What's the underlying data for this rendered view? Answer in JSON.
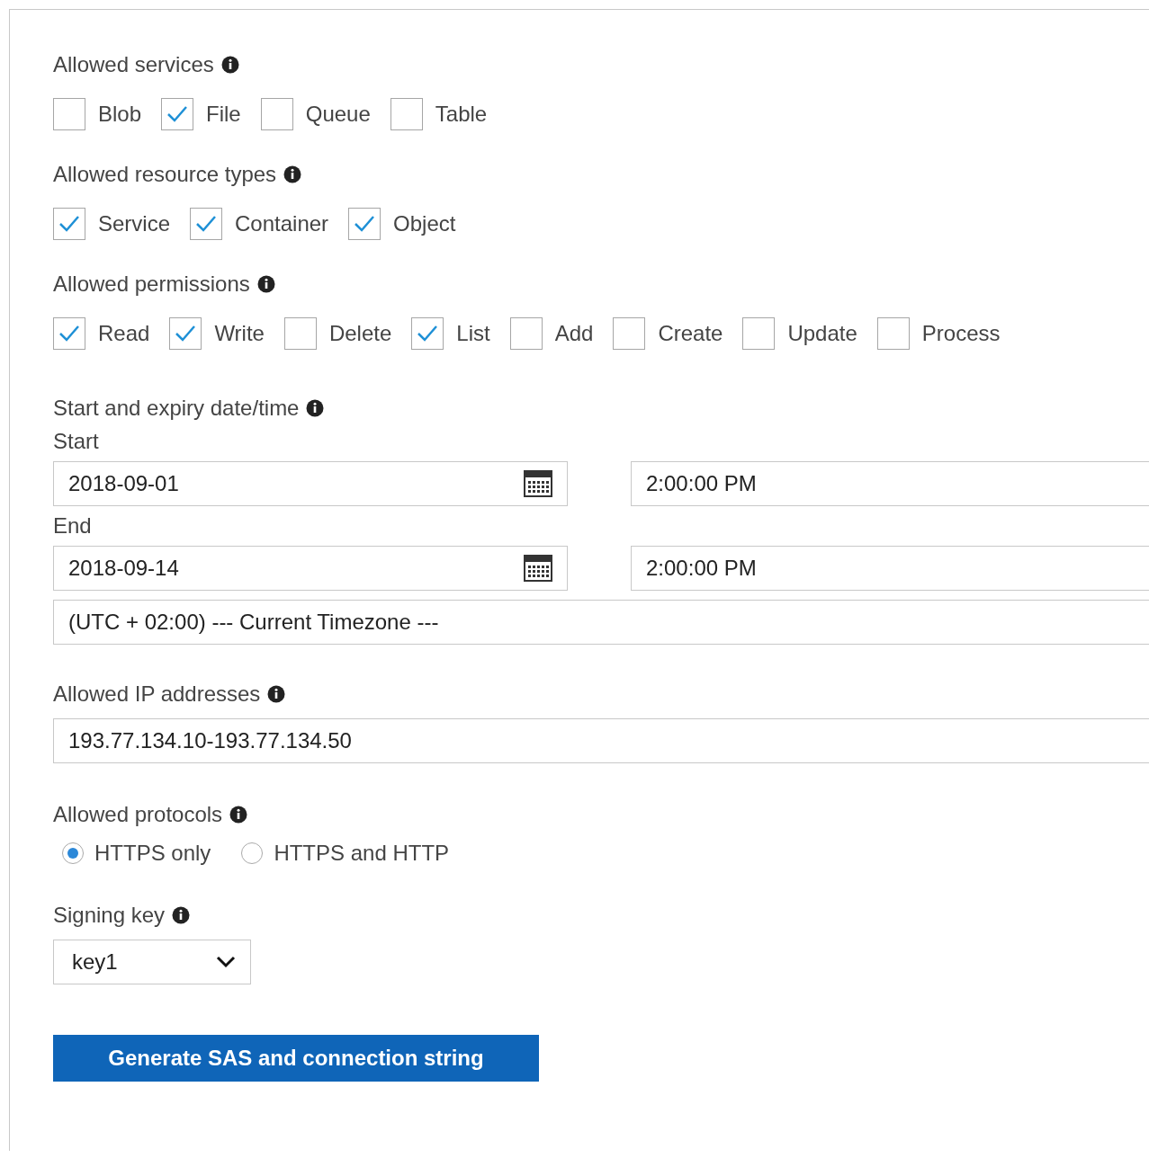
{
  "services": {
    "label": "Allowed services",
    "options": [
      {
        "label": "Blob",
        "checked": false
      },
      {
        "label": "File",
        "checked": true
      },
      {
        "label": "Queue",
        "checked": false
      },
      {
        "label": "Table",
        "checked": false
      }
    ]
  },
  "resource_types": {
    "label": "Allowed resource types",
    "options": [
      {
        "label": "Service",
        "checked": true
      },
      {
        "label": "Container",
        "checked": true
      },
      {
        "label": "Object",
        "checked": true
      }
    ]
  },
  "permissions": {
    "label": "Allowed permissions",
    "options": [
      {
        "label": "Read",
        "checked": true
      },
      {
        "label": "Write",
        "checked": true
      },
      {
        "label": "Delete",
        "checked": false
      },
      {
        "label": "List",
        "checked": true
      },
      {
        "label": "Add",
        "checked": false
      },
      {
        "label": "Create",
        "checked": false
      },
      {
        "label": "Update",
        "checked": false
      },
      {
        "label": "Process",
        "checked": false
      }
    ]
  },
  "dates": {
    "label": "Start and expiry date/time",
    "start_label": "Start",
    "start_date": "2018-09-01",
    "start_time": "2:00:00 PM",
    "end_label": "End",
    "end_date": "2018-09-14",
    "end_time": "2:00:00 PM",
    "timezone": "(UTC + 02:00) --- Current Timezone ---"
  },
  "ip": {
    "label": "Allowed IP addresses",
    "value": "193.77.134.10-193.77.134.50"
  },
  "protocols": {
    "label": "Allowed protocols",
    "options": [
      {
        "label": "HTTPS only",
        "selected": true
      },
      {
        "label": "HTTPS and HTTP",
        "selected": false
      }
    ]
  },
  "signing_key": {
    "label": "Signing key",
    "value": "key1"
  },
  "button": "Generate SAS and connection string"
}
